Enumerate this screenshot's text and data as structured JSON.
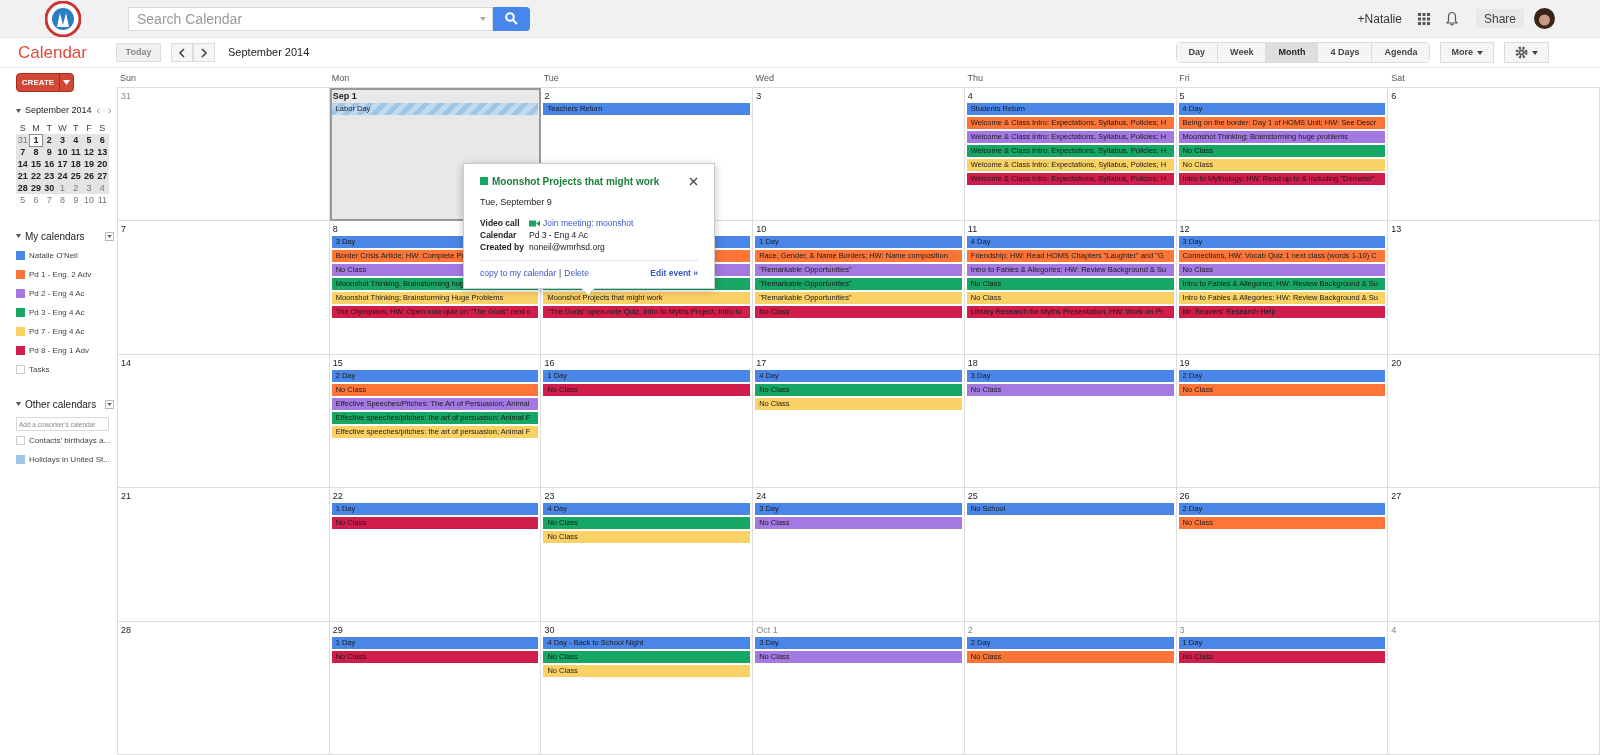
{
  "header": {
    "search": {
      "placeholder": "Search Calendar"
    },
    "user": "+Natalie",
    "share": "Share"
  },
  "toolbar": {
    "title": "Calendar",
    "today": {
      "label": "Today",
      "disabled": true
    },
    "period": "September 2014",
    "views": [
      {
        "label": "Day",
        "selected": false
      },
      {
        "label": "Week",
        "selected": false
      },
      {
        "label": "Month",
        "selected": true
      },
      {
        "label": "4 Days",
        "selected": false
      },
      {
        "label": "Agenda",
        "selected": false
      }
    ],
    "more": "More"
  },
  "sidebar": {
    "create": "CREATE",
    "mini_calendar": {
      "title": "September 2014",
      "weekdays": [
        "S",
        "M",
        "T",
        "W",
        "T",
        "F",
        "S"
      ],
      "weeks": [
        {
          "in_view": true,
          "days": [
            {
              "label": "31",
              "muted": true,
              "selected": false
            },
            {
              "label": "1",
              "muted": false,
              "selected": true
            },
            {
              "label": "2",
              "muted": false,
              "selected": false
            },
            {
              "label": "3",
              "muted": false,
              "selected": false
            },
            {
              "label": "4",
              "muted": false,
              "selected": false
            },
            {
              "label": "5",
              "muted": false,
              "selected": false
            },
            {
              "label": "6",
              "muted": false,
              "selected": false
            }
          ]
        },
        {
          "in_view": true,
          "days": [
            {
              "label": "7",
              "muted": false,
              "selected": false
            },
            {
              "label": "8",
              "muted": false,
              "selected": false
            },
            {
              "label": "9",
              "muted": false,
              "selected": false
            },
            {
              "label": "10",
              "muted": false,
              "selected": false
            },
            {
              "label": "11",
              "muted": false,
              "selected": false
            },
            {
              "label": "12",
              "muted": false,
              "selected": false
            },
            {
              "label": "13",
              "muted": false,
              "selected": false
            }
          ]
        },
        {
          "in_view": true,
          "days": [
            {
              "label": "14",
              "muted": false,
              "selected": false
            },
            {
              "label": "15",
              "muted": false,
              "selected": false
            },
            {
              "label": "16",
              "muted": false,
              "selected": false
            },
            {
              "label": "17",
              "muted": false,
              "selected": false
            },
            {
              "label": "18",
              "muted": false,
              "selected": false
            },
            {
              "label": "19",
              "muted": false,
              "selected": false
            },
            {
              "label": "20",
              "muted": false,
              "selected": false
            }
          ]
        },
        {
          "in_view": true,
          "days": [
            {
              "label": "21",
              "muted": false,
              "selected": false
            },
            {
              "label": "22",
              "muted": false,
              "selected": false
            },
            {
              "label": "23",
              "muted": false,
              "selected": false
            },
            {
              "label": "24",
              "muted": false,
              "selected": false
            },
            {
              "label": "25",
              "muted": false,
              "selected": false
            },
            {
              "label": "26",
              "muted": false,
              "selected": false
            },
            {
              "label": "27",
              "muted": false,
              "selected": false
            }
          ]
        },
        {
          "in_view": true,
          "days": [
            {
              "label": "28",
              "muted": false,
              "selected": false
            },
            {
              "label": "29",
              "muted": false,
              "selected": false
            },
            {
              "label": "30",
              "muted": false,
              "selected": false
            },
            {
              "label": "1",
              "muted": true,
              "selected": false
            },
            {
              "label": "2",
              "muted": true,
              "selected": false
            },
            {
              "label": "3",
              "muted": true,
              "selected": false
            },
            {
              "label": "4",
              "muted": true,
              "selected": false
            }
          ]
        },
        {
          "in_view": false,
          "days": [
            {
              "label": "5",
              "muted": true,
              "selected": false
            },
            {
              "label": "6",
              "muted": true,
              "selected": false
            },
            {
              "label": "7",
              "muted": true,
              "selected": false
            },
            {
              "label": "8",
              "muted": true,
              "selected": false
            },
            {
              "label": "9",
              "muted": true,
              "selected": false
            },
            {
              "label": "10",
              "muted": true,
              "selected": false
            },
            {
              "label": "11",
              "muted": true,
              "selected": false
            }
          ]
        }
      ]
    },
    "my_calendars": {
      "title": "My calendars",
      "items": [
        {
          "label": "Natalie O'Neil",
          "color": "#4986e7",
          "checked": true
        },
        {
          "label": "Pd 1 - Eng. 2 Adv",
          "color": "#ff7537",
          "checked": true
        },
        {
          "label": "Pd 2 - Eng 4 Ac",
          "color": "#a47ae2",
          "checked": true
        },
        {
          "label": "Pd 3 - Eng 4 Ac",
          "color": "#16a765",
          "checked": true
        },
        {
          "label": "Pd 7 - Eng 4 Ac",
          "color": "#fad165",
          "checked": true
        },
        {
          "label": "Pd 8 - Eng 1 Adv",
          "color": "#d11d4b",
          "checked": true
        },
        {
          "label": "Tasks",
          "checked": false
        }
      ]
    },
    "other_calendars": {
      "title": "Other calendars",
      "placeholder": "Add a coworker's calendar",
      "items": [
        {
          "label": "Contacts' birthdays a...",
          "checked": false
        },
        {
          "label": "Holidays in United St...",
          "color": "#9fc6e7",
          "checked": true
        }
      ]
    }
  },
  "month": {
    "weekdays": [
      "Sun",
      "Mon",
      "Tue",
      "Wed",
      "Thu",
      "Fri",
      "Sat"
    ],
    "weeks": [
      [
        {
          "label": "31",
          "muted": true,
          "selected": false
        },
        {
          "label": "Sep 1",
          "muted": false,
          "selected": true,
          "events": [
            {
              "kind": "holiday",
              "text": "Labor Day",
              "color": "#9fc6e7"
            }
          ]
        },
        {
          "label": "2",
          "muted": false,
          "selected": false,
          "events": [
            {
              "kind": "event",
              "text": "Teachers Return",
              "color": "#4986e7"
            }
          ]
        },
        {
          "label": "3",
          "muted": false,
          "selected": false
        },
        {
          "label": "4",
          "muted": false,
          "selected": false,
          "events": [
            {
              "kind": "event",
              "text": "Students Return",
              "color": "#4986e7"
            },
            {
              "kind": "event",
              "text": "Welcome & Class Intro: Expectations, Syllabus, Policies; H",
              "color": "#ff7537"
            },
            {
              "kind": "event",
              "text": "Welcome & Class Intro: Expectations, Syllabus, Policies; H",
              "color": "#a47ae2"
            },
            {
              "kind": "event",
              "text": "Welcome & Class Intro: Expectations, Syllabus, Policies; H",
              "color": "#16a765"
            },
            {
              "kind": "event",
              "text": "Welcome & Class Intro: Expectations, Syllabus, Policies; H",
              "color": "#fad165"
            },
            {
              "kind": "event",
              "text": "Welcome & Class Intro: Expectations, Syllabus, Policies; H",
              "color": "#d11d4b"
            }
          ]
        },
        {
          "label": "5",
          "muted": false,
          "selected": false,
          "events": [
            {
              "kind": "event",
              "text": "4 Day",
              "color": "#4986e7"
            },
            {
              "kind": "event",
              "text": "Being on the border: Day 1 of HOMS Unit; HW: See Descr",
              "color": "#ff7537"
            },
            {
              "kind": "event",
              "text": "Moonshot Thinking; Brainstorming huge problems",
              "color": "#a47ae2"
            },
            {
              "kind": "event",
              "text": "No Class",
              "color": "#16a765"
            },
            {
              "kind": "event",
              "text": "No Class",
              "color": "#fad165"
            },
            {
              "kind": "event",
              "text": "Intro to Mythology; HW: Read up to & including \"Demeter\"",
              "color": "#d11d4b"
            }
          ]
        },
        {
          "label": "6",
          "muted": false,
          "selected": false
        }
      ],
      [
        {
          "label": "7",
          "muted": false,
          "selected": false
        },
        {
          "label": "8",
          "muted": false,
          "selected": false,
          "events": [
            {
              "kind": "event",
              "text": "3 Day",
              "color": "#4986e7"
            },
            {
              "kind": "event",
              "text": "Border Crisis Article; HW: Complete Pr",
              "color": "#ff7537"
            },
            {
              "kind": "event",
              "text": "No Class",
              "color": "#a47ae2"
            },
            {
              "kind": "event",
              "text": "Moonshot Thinking, Brainstorming hug",
              "color": "#16a765"
            },
            {
              "kind": "event",
              "text": "Moonshot Thinking; Brainstorming Huge Problems",
              "color": "#fad165"
            },
            {
              "kind": "event",
              "text": "The Olympians, HW: Open note quiz on \"The Gods\" next c",
              "color": "#d11d4b"
            }
          ]
        },
        {
          "selected": false,
          "events": [
            {
              "kind": "event",
              "color": "#4986e7"
            },
            {
              "kind": "event",
              "color": "#ff7537"
            },
            {
              "kind": "event",
              "color": "#a47ae2"
            },
            {
              "kind": "event",
              "color": "#16a765"
            },
            {
              "kind": "event",
              "text": "Moonshot Projects that might work",
              "color": "#fad165"
            },
            {
              "kind": "event",
              "text": "\"The Gods\" open-note Quiz, Intro to Myths Project, Intro to",
              "color": "#d11d4b"
            }
          ]
        },
        {
          "label": "10",
          "muted": false,
          "selected": false,
          "events": [
            {
              "kind": "event",
              "text": "1 Day",
              "color": "#4986e7"
            },
            {
              "kind": "event",
              "text": "Race, Gender, & Name Borders; HW: Name composition",
              "color": "#ff7537"
            },
            {
              "kind": "event",
              "text": "\"Remarkable Opportunities\"",
              "color": "#a47ae2"
            },
            {
              "kind": "event",
              "text": "\"Remarkable Opportunities\"",
              "color": "#16a765"
            },
            {
              "kind": "event",
              "text": "\"Remarkable Opportunities\"",
              "color": "#fad165"
            },
            {
              "kind": "event",
              "text": "No Class",
              "color": "#d11d4b"
            }
          ]
        },
        {
          "label": "11",
          "muted": false,
          "selected": false,
          "events": [
            {
              "kind": "event",
              "text": "4 Day",
              "color": "#4986e7"
            },
            {
              "kind": "event",
              "text": "Friendship; HW: Read HOMS Chapters \"Laughter\" and \"G",
              "color": "#ff7537"
            },
            {
              "kind": "event",
              "text": "Intro to Fables & Allegories; HW: Review Background & Su",
              "color": "#a47ae2"
            },
            {
              "kind": "event",
              "text": "No Class",
              "color": "#16a765"
            },
            {
              "kind": "event",
              "text": "No Class",
              "color": "#fad165"
            },
            {
              "kind": "event",
              "text": "Library Research for Myths Presentation; HW: Work on Pr",
              "color": "#d11d4b"
            }
          ]
        },
        {
          "label": "12",
          "muted": false,
          "selected": false,
          "events": [
            {
              "kind": "event",
              "text": "3 Day",
              "color": "#4986e7"
            },
            {
              "kind": "event",
              "text": "Connections, HW: Vocab Quiz 1 next class (words 1-10) C",
              "color": "#ff7537"
            },
            {
              "kind": "event",
              "text": "No Class",
              "color": "#a47ae2"
            },
            {
              "kind": "event",
              "text": "Intro to Fables & Allegories; HW: Review Background & Su",
              "color": "#16a765"
            },
            {
              "kind": "event",
              "text": "Intro to Fables & Allegories; HW: Review Background & Su",
              "color": "#fad165"
            },
            {
              "kind": "event",
              "text": "Mr. Beavers' Research Help",
              "color": "#d11d4b"
            }
          ]
        },
        {
          "label": "13",
          "muted": false,
          "selected": false
        }
      ],
      [
        {
          "label": "14",
          "muted": false,
          "selected": false
        },
        {
          "label": "15",
          "muted": false,
          "selected": false,
          "events": [
            {
              "kind": "event",
              "text": "2 Day",
              "color": "#4986e7"
            },
            {
              "kind": "event",
              "text": "No Class",
              "color": "#ff7537"
            },
            {
              "kind": "event",
              "text": "Effective Speeches/Pitches: The Art of Persuasion; Animal",
              "color": "#a47ae2"
            },
            {
              "kind": "event",
              "text": "Effective speeches/pitches: the art of persuasion; Animal F",
              "color": "#16a765"
            },
            {
              "kind": "event",
              "text": "Effective speeches/pitches: the art of persuasion; Animal F",
              "color": "#fad165"
            }
          ]
        },
        {
          "label": "16",
          "muted": false,
          "selected": false,
          "events": [
            {
              "kind": "event",
              "text": "1 Day",
              "color": "#4986e7"
            },
            {
              "kind": "event",
              "text": "No Class",
              "color": "#d11d4b"
            }
          ]
        },
        {
          "label": "17",
          "muted": false,
          "selected": false,
          "events": [
            {
              "kind": "event",
              "text": "4 Day",
              "color": "#4986e7"
            },
            {
              "kind": "event",
              "text": "No Class",
              "color": "#16a765"
            },
            {
              "kind": "event",
              "text": "No Class",
              "color": "#fad165"
            }
          ]
        },
        {
          "label": "18",
          "muted": false,
          "selected": false,
          "events": [
            {
              "kind": "event",
              "text": "3 Day",
              "color": "#4986e7"
            },
            {
              "kind": "event",
              "text": "No Class",
              "color": "#a47ae2"
            }
          ]
        },
        {
          "label": "19",
          "muted": false,
          "selected": false,
          "events": [
            {
              "kind": "event",
              "text": "2 Day",
              "color": "#4986e7"
            },
            {
              "kind": "event",
              "text": "No Class",
              "color": "#ff7537"
            }
          ]
        },
        {
          "label": "20",
          "muted": false,
          "selected": false
        }
      ],
      [
        {
          "label": "21",
          "muted": false,
          "selected": false
        },
        {
          "label": "22",
          "muted": false,
          "selected": false,
          "events": [
            {
              "kind": "event",
              "text": "1 Day",
              "color": "#4986e7"
            },
            {
              "kind": "event",
              "text": "No Class",
              "color": "#d11d4b"
            }
          ]
        },
        {
          "label": "23",
          "muted": false,
          "selected": false,
          "events": [
            {
              "kind": "event",
              "text": "4 Day",
              "color": "#4986e7"
            },
            {
              "kind": "event",
              "text": "No Class",
              "color": "#16a765"
            },
            {
              "kind": "event",
              "text": "No Class",
              "color": "#fad165"
            }
          ]
        },
        {
          "label": "24",
          "muted": false,
          "selected": false,
          "events": [
            {
              "kind": "event",
              "text": "3 Day",
              "color": "#4986e7"
            },
            {
              "kind": "event",
              "text": "No Class",
              "color": "#a47ae2"
            }
          ]
        },
        {
          "label": "25",
          "muted": false,
          "selected": false,
          "events": [
            {
              "kind": "event",
              "text": "No School",
              "color": "#4986e7"
            }
          ]
        },
        {
          "label": "26",
          "muted": false,
          "selected": false,
          "events": [
            {
              "kind": "event",
              "text": "2 Day",
              "color": "#4986e7"
            },
            {
              "kind": "event",
              "text": "No Class",
              "color": "#ff7537"
            }
          ]
        },
        {
          "label": "27",
          "muted": false,
          "selected": false
        }
      ],
      [
        {
          "label": "28",
          "muted": false,
          "selected": false
        },
        {
          "label": "29",
          "muted": false,
          "selected": false,
          "events": [
            {
              "kind": "event",
              "text": "1 Day",
              "color": "#4986e7"
            },
            {
              "kind": "event",
              "text": "No Class",
              "color": "#d11d4b"
            }
          ]
        },
        {
          "label": "30",
          "muted": false,
          "selected": false,
          "events": [
            {
              "kind": "event",
              "text": "4 Day - Back to School Night",
              "color": "#4986e7"
            },
            {
              "kind": "event",
              "text": "No Class",
              "color": "#16a765"
            },
            {
              "kind": "event",
              "text": "No Class",
              "color": "#fad165"
            }
          ]
        },
        {
          "label": "Oct 1",
          "muted": true,
          "selected": false,
          "events": [
            {
              "kind": "event",
              "text": "3 Day",
              "color": "#4986e7"
            },
            {
              "kind": "event",
              "text": "No Class",
              "color": "#a47ae2"
            }
          ]
        },
        {
          "label": "2",
          "muted": true,
          "selected": false,
          "events": [
            {
              "kind": "event",
              "text": "2 Day",
              "color": "#4986e7"
            },
            {
              "kind": "event",
              "text": "No Class",
              "color": "#ff7537"
            }
          ]
        },
        {
          "label": "3",
          "muted": true,
          "selected": false,
          "events": [
            {
              "kind": "event",
              "text": "1 Day",
              "color": "#4986e7"
            },
            {
              "kind": "event",
              "text": "No Class",
              "color": "#d11d4b"
            }
          ]
        },
        {
          "label": "4",
          "muted": true,
          "selected": false
        }
      ]
    ]
  },
  "popup": {
    "title": "Moonshot Projects that might work",
    "color": "#16a765",
    "date": "Tue, September 9",
    "details": [
      {
        "label": "Video call",
        "value": "Join meeting: moonshot",
        "kind": "link"
      },
      {
        "label": "Calendar",
        "value": "Pd 3 - Eng 4 Ac",
        "kind": "text"
      },
      {
        "label": "Created by",
        "value": "noneil@wmrhsd.org",
        "kind": "text"
      }
    ],
    "copy": "copy to my calendar",
    "separator": "|",
    "delete": "Delete",
    "edit": "Edit event »"
  }
}
